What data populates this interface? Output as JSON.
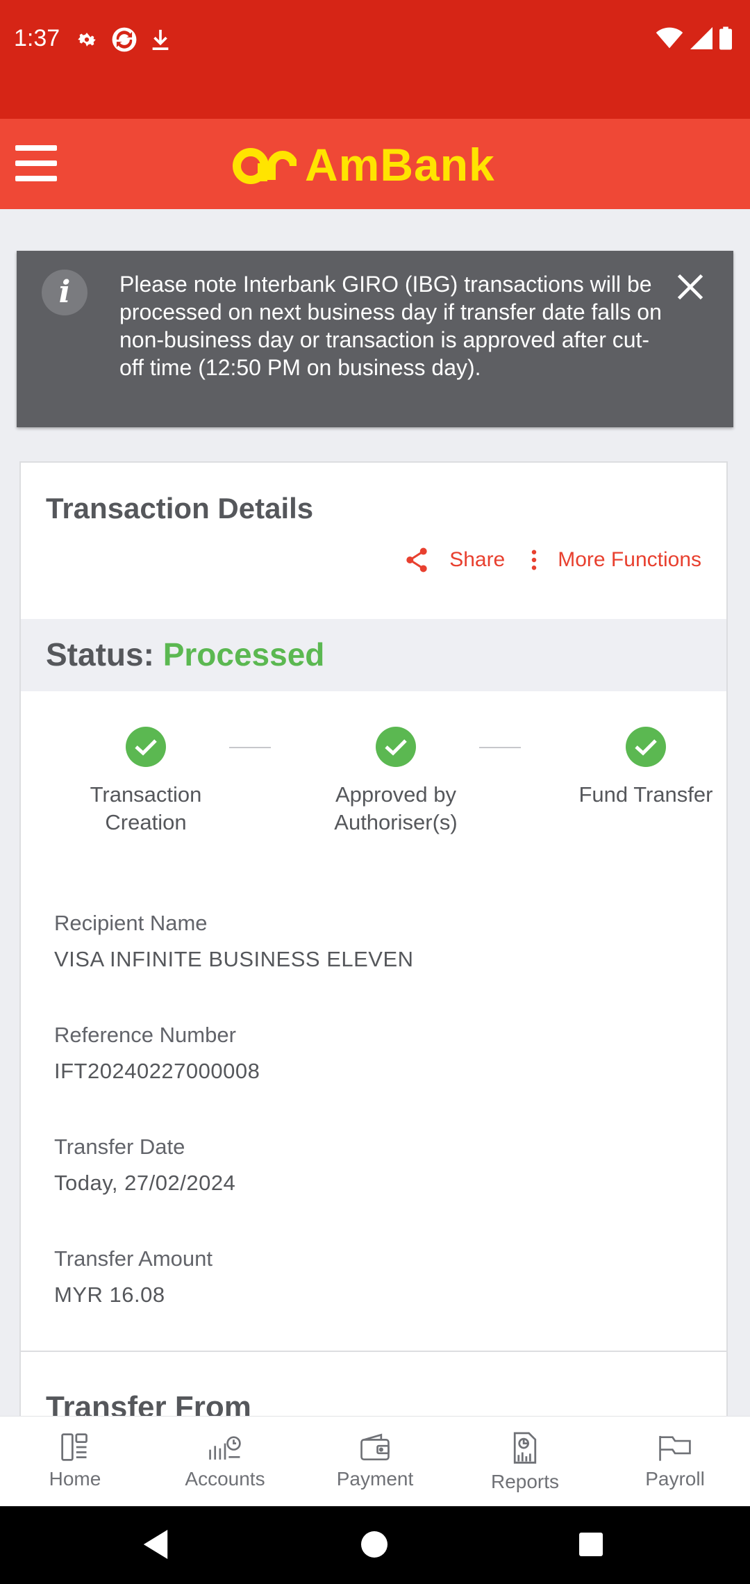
{
  "status_bar": {
    "time": "1:37",
    "left_icons": [
      "gear-icon",
      "sync-icon",
      "download-icon"
    ],
    "right_icons": [
      "wifi-icon",
      "signal-icon",
      "battery-icon"
    ]
  },
  "header": {
    "brand": "AmBank",
    "menu_icon": "hamburger-menu-icon",
    "colors": {
      "header": "#ef4836",
      "status_bar": "#d62516",
      "logo": "#ffe400"
    }
  },
  "notice": {
    "text": "Please note Interbank GIRO (IBG) transactions will be processed on next business day if transfer date falls on non-business day or transaction is approved after cut-off time (12:50 PM on business day).",
    "icon": "info-icon",
    "close_icon": "close-icon"
  },
  "card": {
    "title": "Transaction Details",
    "share_label": "Share",
    "more_label": "More Functions",
    "status_label": "Status:",
    "status_value": "Processed",
    "status_color": "#5bb851",
    "steps": [
      {
        "label": "Transaction Creation",
        "done": true
      },
      {
        "label": "Approved by Authoriser(s)",
        "done": true
      },
      {
        "label": "Fund Transfer",
        "done": true
      }
    ],
    "fields": [
      {
        "label": "Recipient Name",
        "value": "VISA INFINITE BUSINESS ELEVEN"
      },
      {
        "label": "Reference Number",
        "value": "IFT20240227000008"
      },
      {
        "label": "Transfer Date",
        "value": "Today, 27/02/2024"
      },
      {
        "label": "Transfer Amount",
        "value": "MYR 16.08"
      }
    ],
    "next_section": "Transfer From"
  },
  "bottom_nav": {
    "items": [
      {
        "label": "Home",
        "icon": "home-icon"
      },
      {
        "label": "Accounts",
        "icon": "accounts-icon"
      },
      {
        "label": "Payment",
        "icon": "wallet-icon"
      },
      {
        "label": "Reports",
        "icon": "reports-icon"
      },
      {
        "label": "Payroll",
        "icon": "payroll-icon"
      }
    ]
  }
}
